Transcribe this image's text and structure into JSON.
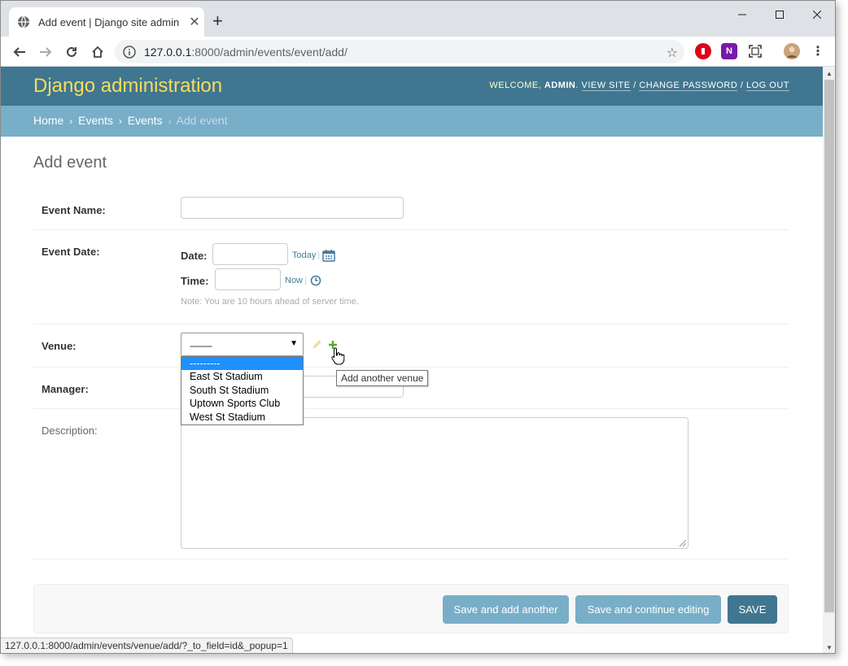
{
  "browser": {
    "tab_title": "Add event | Django site admin",
    "new_tab": "+",
    "url_host": "127.0.0.1",
    "url_rest": ":8000/admin/events/event/add/",
    "status_url": "127.0.0.1:8000/admin/events/venue/add/?_to_field=id&_popup=1"
  },
  "header": {
    "branding": "Django administration",
    "welcome": "WELCOME,",
    "user": "ADMIN",
    "sep_dot": ".",
    "view_site": "VIEW SITE",
    "slash": "/",
    "change_password": "CHANGE PASSWORD",
    "log_out": "LOG OUT"
  },
  "breadcrumbs": {
    "home": "Home",
    "events_app": "Events",
    "events_model": "Events",
    "current": "Add event",
    "sep": "›"
  },
  "page": {
    "title": "Add event"
  },
  "form": {
    "event_name_label": "Event Name:",
    "event_name_value": "",
    "event_date_label": "Event Date:",
    "date_label": "Date:",
    "today_link": "Today",
    "time_label": "Time:",
    "now_link": "Now",
    "pipe": "|",
    "server_note": "Note: You are 10 hours ahead of server time.",
    "venue_label": "Venue:",
    "venue_selected": "---------",
    "venue_options": [
      "---------",
      "East St Stadium",
      "South St Stadium",
      "Uptown Sports Club",
      "West St Stadium"
    ],
    "add_venue_tooltip": "Add another venue",
    "manager_label": "Manager:",
    "description_label": "Description:"
  },
  "buttons": {
    "save_add_another": "Save and add another",
    "save_continue": "Save and continue editing",
    "save": "SAVE"
  },
  "colors": {
    "header_bg": "#417690",
    "breadcrumbs_bg": "#79aec8",
    "branding": "#f5dd5d",
    "add_green": "#5aac2a"
  }
}
